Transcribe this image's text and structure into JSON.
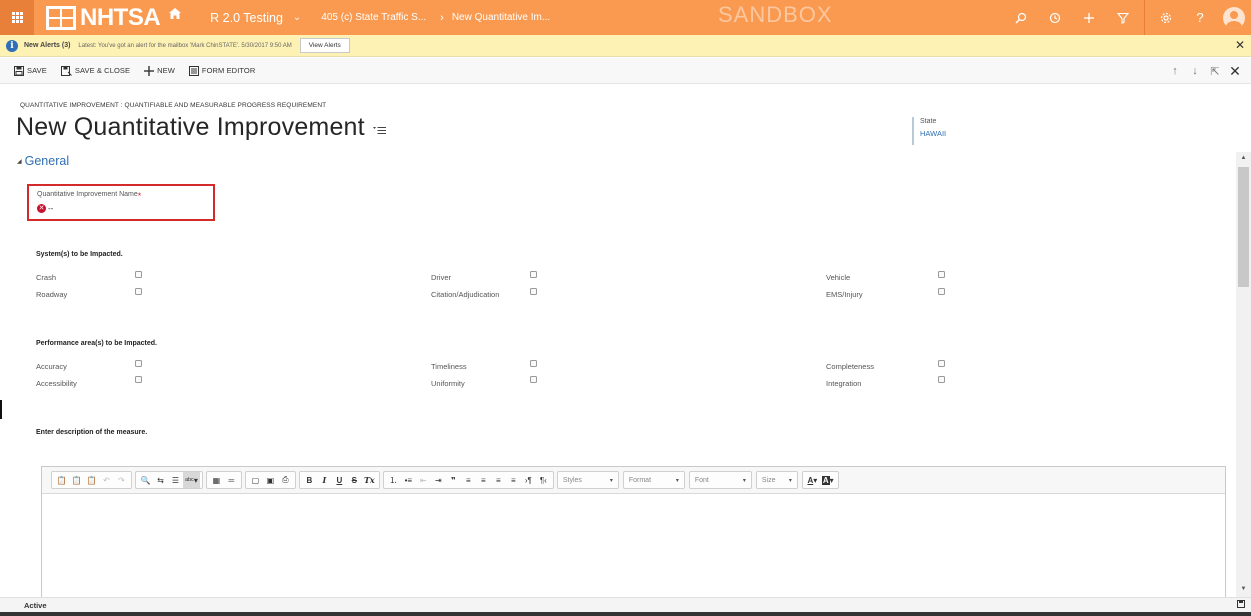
{
  "nav": {
    "logo_text": "NHTSA",
    "area": "R 2.0 Testing",
    "entity": "405 (c) State Traffic S...",
    "record": "New Quantitative Im...",
    "watermark": "SANDBOX",
    "icons": [
      "app-launcher-icon",
      "home-icon",
      "search-icon",
      "history-icon",
      "create-icon",
      "filter-icon",
      "settings-icon",
      "help-icon",
      "user-avatar-icon"
    ]
  },
  "alert": {
    "title": "New Alerts (3)",
    "message": "Latest: You've got an alert for the mailbox 'Mark ChinSTATE'. 5/30/2017 9:50 AM",
    "button": "View Alerts"
  },
  "commands": {
    "save": "SAVE",
    "save_close": "SAVE & CLOSE",
    "new": "NEW",
    "form_editor": "FORM EDITOR"
  },
  "form": {
    "entity_label": "QUANTITATIVE IMPROVEMENT : QUANTIFIABLE AND MEASURABLE PROGRESS REQUIREMENT",
    "title": "New Quantitative Improvement",
    "header_field": {
      "label": "State",
      "value": "HAWAII"
    },
    "section": "General",
    "name_field": {
      "label": "Quantitative Improvement Name",
      "required": "*",
      "value": "--"
    },
    "systems": {
      "heading": "System(s) to be Impacted.",
      "items": [
        "Crash",
        "Driver",
        "Vehicle",
        "Roadway",
        "Citation/Adjudication",
        "EMS/Injury"
      ]
    },
    "performance": {
      "heading": "Performance area(s) to be Impacted.",
      "items": [
        "Accuracy",
        "Timeliness",
        "Completeness",
        "Accessibility",
        "Uniformity",
        "Integration"
      ]
    },
    "description_heading": "Enter description of the measure.",
    "editor": {
      "styles": "Styles",
      "format": "Format",
      "font": "Font",
      "size": "Size"
    }
  },
  "footer": {
    "status": "Active"
  }
}
